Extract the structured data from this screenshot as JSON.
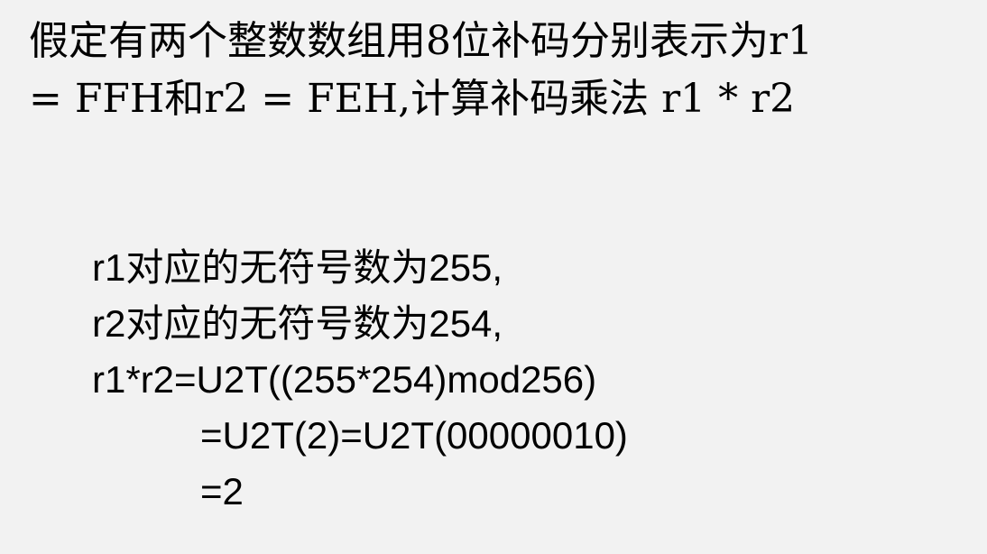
{
  "title": {
    "line1": "假定有两个整数数组用8位补码分别表示为r1",
    "line2": "= FFH和r2 = FEH,计算补码乘法 r1 * r2"
  },
  "body": {
    "lines": [
      "r1对应的无符号数为255,",
      "r2对应的无符号数为254,",
      "r1*r2=U2T((255*254)mod256)",
      "=U2T(2)=U2T(00000010)",
      "=2"
    ]
  }
}
